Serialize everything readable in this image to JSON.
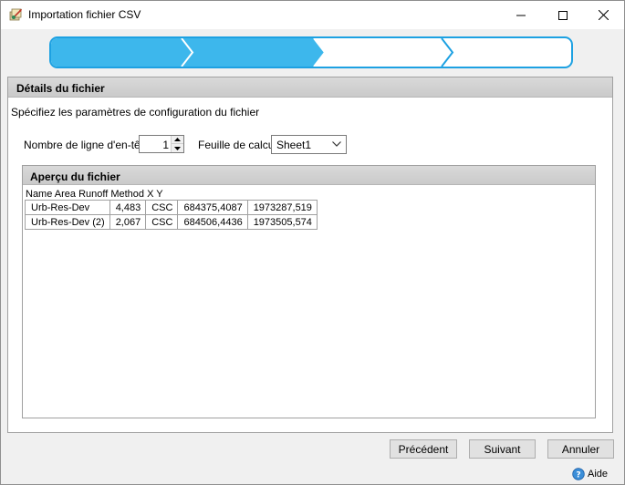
{
  "window": {
    "title": "Importation fichier CSV",
    "icon": "csv-import-app-icon"
  },
  "wizard": {
    "steps": 4,
    "completed_steps": 2,
    "accent_color": "#1da1e2",
    "fill_color": "#3db7ec"
  },
  "details": {
    "header": "Détails du fichier",
    "description": "Spécifiez les paramètres de configuration du fichier",
    "header_lines_label": "Nombre de ligne d'en-tête",
    "header_lines_value": "1",
    "sheet_label": "Feuille de calcul",
    "sheet_value": "Sheet1"
  },
  "preview": {
    "header": "Aperçu du fichier",
    "raw_header": "Name Area Runoff Method X Y",
    "rows": [
      [
        "Urb-Res-Dev",
        "4,483",
        "CSC",
        "684375,4087",
        "1973287,519"
      ],
      [
        "Urb-Res-Dev (2)",
        "2,067",
        "CSC",
        "684506,4436",
        "1973505,574"
      ]
    ]
  },
  "buttons": {
    "previous": "Précédent",
    "next": "Suivant",
    "cancel": "Annuler",
    "help": "Aide"
  }
}
